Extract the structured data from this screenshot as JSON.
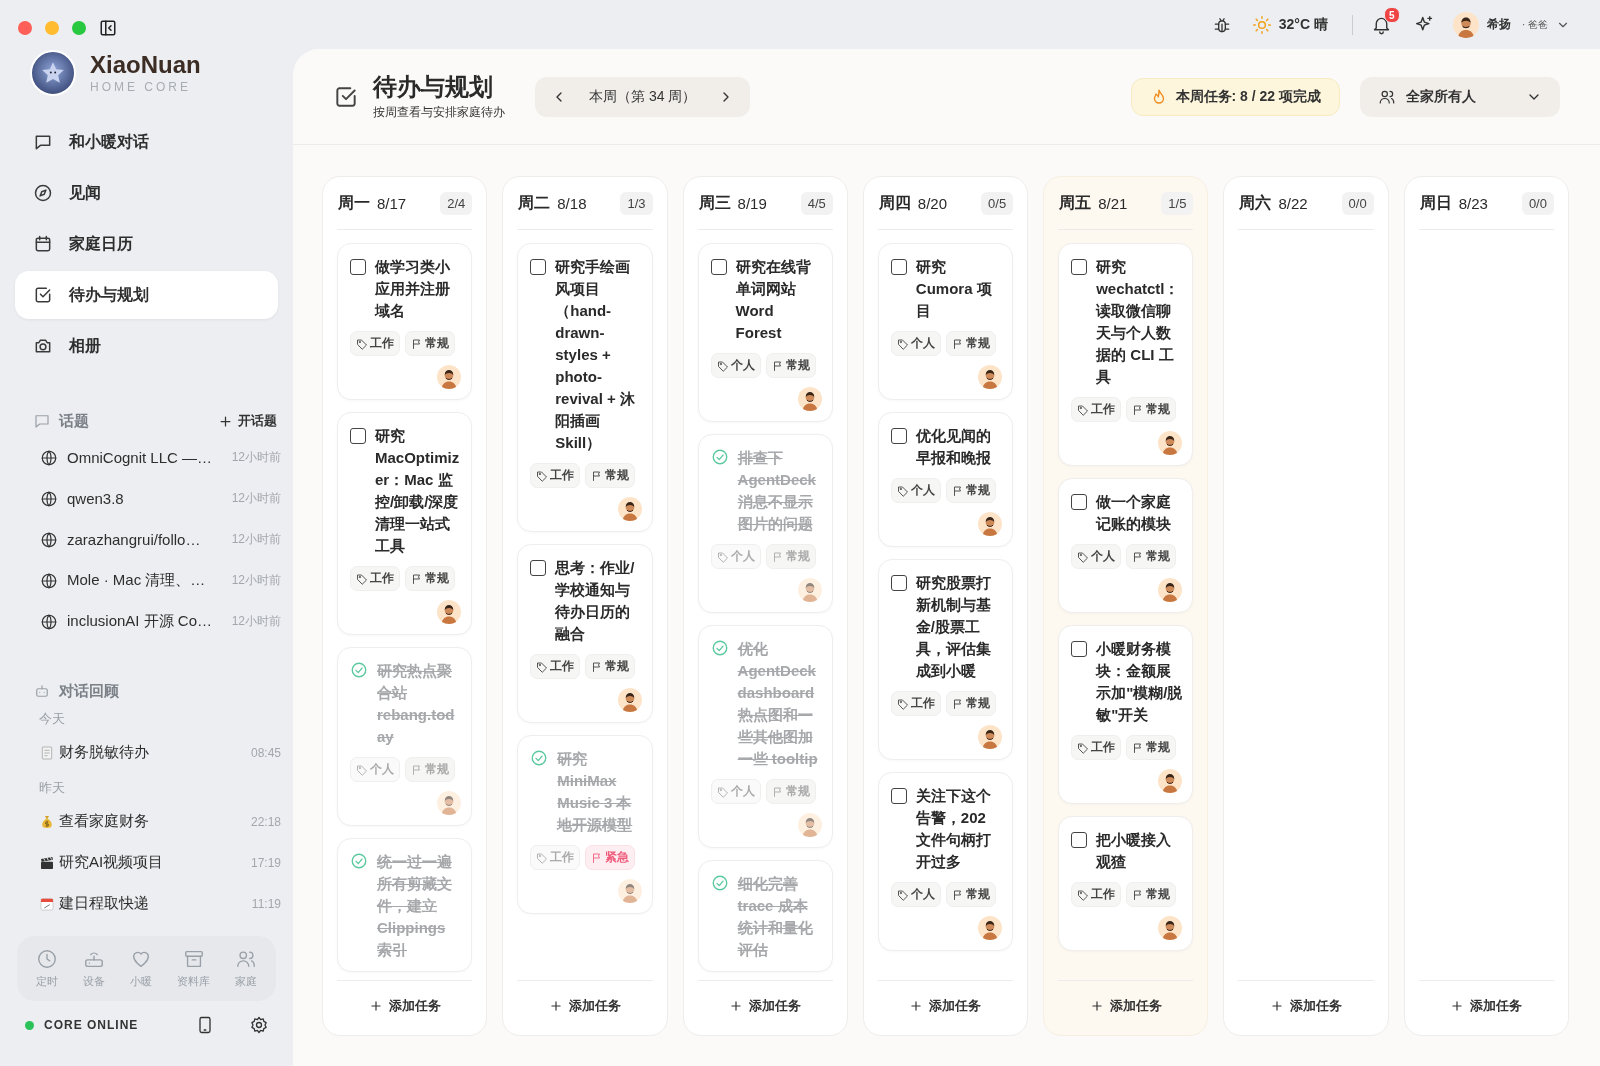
{
  "app": {
    "name": "XiaoNuan",
    "subtitle": "HOME CORE"
  },
  "nav": [
    {
      "label": "和小暖对话",
      "selected": false
    },
    {
      "label": "见闻",
      "selected": false
    },
    {
      "label": "家庭日历",
      "selected": false
    },
    {
      "label": "待办与规划",
      "selected": true
    },
    {
      "label": "相册",
      "selected": false
    }
  ],
  "topics": {
    "title": "话题",
    "new_label": "开话题",
    "items": [
      {
        "title": "OmniCognit LLC —…",
        "time": "12小时前"
      },
      {
        "title": "qwen3.8",
        "time": "12小时前"
      },
      {
        "title": "zarazhangrui/follo…",
        "time": "12小时前"
      },
      {
        "title": "Mole · Mac 清理、…",
        "time": "12小时前"
      },
      {
        "title": "inclusionAI 开源 Co…",
        "time": "12小时前"
      }
    ]
  },
  "history": {
    "title": "对话回顾",
    "groups": [
      {
        "label": "今天",
        "items": [
          {
            "title": "财务脱敏待办",
            "time": "08:45"
          }
        ]
      },
      {
        "label": "昨天",
        "items": [
          {
            "title": "查看家庭财务",
            "time": "22:18"
          },
          {
            "title": "研究AI视频项目",
            "time": "17:19"
          },
          {
            "title": "建日程取快递",
            "time": "11:19"
          }
        ]
      }
    ]
  },
  "dock": [
    {
      "label": "定时"
    },
    {
      "label": "设备"
    },
    {
      "label": "小暖"
    },
    {
      "label": "资料库"
    },
    {
      "label": "家庭"
    }
  ],
  "status": {
    "label": "CORE ONLINE",
    "online": true
  },
  "topbar": {
    "weather": "32°C 晴",
    "notifications": "5",
    "user": "希扬",
    "role": "· 爸爸"
  },
  "header": {
    "title": "待办与规划",
    "subtitle": "按周查看与安排家庭待办",
    "week": "本周（第 34 周）",
    "progress": "本周任务: 8 / 22 项完成",
    "member_filter": "全家所有人"
  },
  "columns": [
    {
      "day": "周一",
      "date": "8/17",
      "count": "2/4",
      "today": false,
      "add_label": "添加任务",
      "tasks": [
        {
          "title": "做学习类小应用并注册域名",
          "done": false,
          "category": "工作",
          "priority": "常规",
          "urgent": false
        },
        {
          "title": "研究 MacOptimizer：Mac 监控/卸载/深度清理一站式工具",
          "done": false,
          "category": "工作",
          "priority": "常规",
          "urgent": false
        },
        {
          "title": "研究热点聚合站 rebang.today",
          "done": true,
          "category": "个人",
          "priority": "常规",
          "urgent": false
        },
        {
          "title": "统一过一遍所有剪藏文件，建立 Clippings 索引",
          "done": true
        }
      ]
    },
    {
      "day": "周二",
      "date": "8/18",
      "count": "1/3",
      "today": false,
      "add_label": "添加任务",
      "tasks": [
        {
          "title": "研究手绘画风项目（hand-drawn-styles + photo-revival + 沐阳插画 Skill）",
          "done": false,
          "category": "工作",
          "priority": "常规",
          "urgent": false
        },
        {
          "title": "思考：作业/学校通知与待办日历的融合",
          "done": false,
          "category": "工作",
          "priority": "常规",
          "urgent": false
        },
        {
          "title": "研究 MiniMax Music 3 本地开源模型",
          "done": true,
          "category": "工作",
          "priority": "紧急",
          "urgent": true
        }
      ]
    },
    {
      "day": "周三",
      "date": "8/19",
      "count": "4/5",
      "today": false,
      "add_label": "添加任务",
      "tasks": [
        {
          "title": "研究在线背单词网站 Word Forest",
          "done": false,
          "category": "个人",
          "priority": "常规",
          "urgent": false
        },
        {
          "title": "排查下 AgentDeck 消息不显示图片的问题",
          "done": true,
          "category": "个人",
          "priority": "常规",
          "urgent": false
        },
        {
          "title": "优化 AgentDeck dashboard 热点图和一些其他图加一些 tooltip",
          "done": true,
          "category": "个人",
          "priority": "常规",
          "urgent": false
        },
        {
          "title": "细化完善 trace 成本统计和量化评估",
          "done": true
        }
      ]
    },
    {
      "day": "周四",
      "date": "8/20",
      "count": "0/5",
      "today": false,
      "add_label": "添加任务",
      "tasks": [
        {
          "title": "研究 Cumora 项目",
          "done": false,
          "category": "个人",
          "priority": "常规",
          "urgent": false
        },
        {
          "title": "优化见闻的早报和晚报",
          "done": false,
          "category": "个人",
          "priority": "常规",
          "urgent": false
        },
        {
          "title": "研究股票打新机制与基金/股票工具，评估集成到小暖",
          "done": false,
          "category": "工作",
          "priority": "常规",
          "urgent": false
        },
        {
          "title": "关注下这个告警，202 文件句柄打开过多",
          "done": false,
          "category": "个人",
          "priority": "常规",
          "urgent": false
        }
      ]
    },
    {
      "day": "周五",
      "date": "8/21",
      "count": "1/5",
      "today": true,
      "add_label": "添加任务",
      "tasks": [
        {
          "title": "研究 wechatctl：读取微信聊天与个人数据的 CLI 工具",
          "done": false,
          "category": "工作",
          "priority": "常规",
          "urgent": false
        },
        {
          "title": "做一个家庭记账的模块",
          "done": false,
          "category": "个人",
          "priority": "常规",
          "urgent": false
        },
        {
          "title": "小暖财务模块：金额展示加\"模糊/脱敏\"开关",
          "done": false,
          "category": "工作",
          "priority": "常规",
          "urgent": false
        },
        {
          "title": "把小暖接入观猹",
          "done": false,
          "category": "工作",
          "priority": "常规",
          "urgent": false
        }
      ]
    },
    {
      "day": "周六",
      "date": "8/22",
      "count": "0/0",
      "today": false,
      "add_label": "添加任务"
    },
    {
      "day": "周日",
      "date": "8/23",
      "count": "0/0",
      "today": false,
      "add_label": "添加任务"
    }
  ]
}
